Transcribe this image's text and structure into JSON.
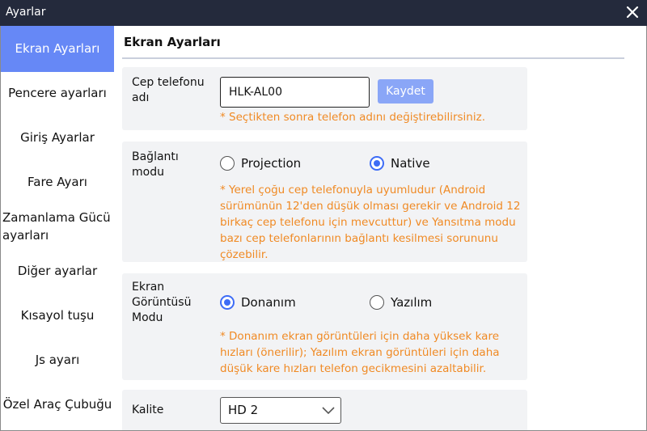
{
  "window": {
    "title": "Ayarlar",
    "close_icon": "close-icon"
  },
  "sidebar": {
    "items": [
      {
        "label": "Ekran Ayarları",
        "active": true
      },
      {
        "label": "Pencere ayarları"
      },
      {
        "label": "Giriş Ayarlar"
      },
      {
        "label": "Fare Ayarı"
      },
      {
        "label": "Zamanlama Gücü ayarları"
      },
      {
        "label": "Diğer ayarlar"
      },
      {
        "label": "Kısayol tuşu"
      },
      {
        "label": "Js ayarı"
      },
      {
        "label": "Özel Araç Çubuğu"
      }
    ]
  },
  "main": {
    "title": "Ekran Ayarları",
    "phone_name": {
      "label": "Cep telefonu adı",
      "value": "HLK-AL00",
      "save_label": "Kaydet",
      "note": "* Seçtikten sonra telefon adını değiştirebilirsiniz."
    },
    "connection_mode": {
      "label": "Bağlantı modu",
      "options": [
        "Projection",
        "Native"
      ],
      "selected": "Native",
      "note": "* Yerel çoğu cep telefonuyla uyumludur (Android sürümünün 12'den düşük olması gerekir ve Android 12 birkaç cep telefonu için mevcuttur) ve Yansıtma modu bazı cep telefonlarının bağlantı kesilmesi sorununu çözebilir."
    },
    "screen_display_mode": {
      "label": "Ekran Görüntüsü Modu",
      "options": [
        "Donanım",
        "Yazılım"
      ],
      "selected": "Donanım",
      "note": "* Donanım ekran görüntüleri için daha yüksek kare hızları (önerilir); Yazılım ekran görüntüleri için daha düşük kare hızları telefon gecikmesini azaltabilir."
    },
    "quality": {
      "label": "Kalite",
      "value": "HD 2"
    }
  },
  "colors": {
    "titlebar": "#242a3c",
    "accent": "#6688f6",
    "note": "#f08a24",
    "radio": "#3d6cf6"
  }
}
